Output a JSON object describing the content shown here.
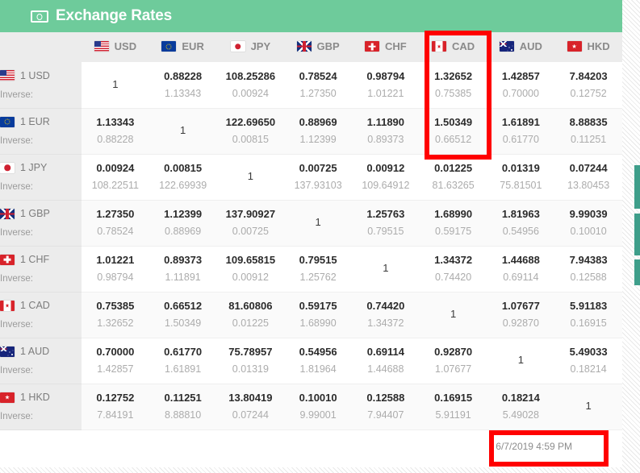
{
  "header": {
    "title": "Exchange Rates",
    "icon": "money-bill-icon",
    "background_color": "#6ECB9B"
  },
  "table": {
    "inverse_label": "Inverse:",
    "identity_value": "1",
    "columns": [
      {
        "code": "USD",
        "flag": "flag-usd"
      },
      {
        "code": "EUR",
        "flag": "flag-eur"
      },
      {
        "code": "JPY",
        "flag": "flag-jpy"
      },
      {
        "code": "GBP",
        "flag": "flag-gbp"
      },
      {
        "code": "CHF",
        "flag": "flag-chf"
      },
      {
        "code": "CAD",
        "flag": "flag-cad"
      },
      {
        "code": "AUD",
        "flag": "flag-aud"
      },
      {
        "code": "HKD",
        "flag": "flag-hkd"
      }
    ],
    "rows": [
      {
        "label": "1 USD",
        "flag": "flag-usd",
        "rates": [
          "1",
          "0.88228",
          "108.25286",
          "0.78524",
          "0.98794",
          "1.32652",
          "1.42857",
          "7.84203"
        ],
        "inverses": [
          "",
          "1.13343",
          "0.00924",
          "1.27350",
          "1.01221",
          "0.75385",
          "0.70000",
          "0.12752"
        ]
      },
      {
        "label": "1 EUR",
        "flag": "flag-eur",
        "rates": [
          "1.13343",
          "1",
          "122.69650",
          "0.88969",
          "1.11890",
          "1.50349",
          "1.61891",
          "8.88835"
        ],
        "inverses": [
          "0.88228",
          "",
          "0.00815",
          "1.12399",
          "0.89373",
          "0.66512",
          "0.61770",
          "0.11251"
        ]
      },
      {
        "label": "1 JPY",
        "flag": "flag-jpy",
        "rates": [
          "0.00924",
          "0.00815",
          "1",
          "0.00725",
          "0.00912",
          "0.01225",
          "0.01319",
          "0.07244"
        ],
        "inverses": [
          "108.22511",
          "122.69939",
          "",
          "137.93103",
          "109.64912",
          "81.63265",
          "75.81501",
          "13.80453"
        ]
      },
      {
        "label": "1 GBP",
        "flag": "flag-gbp",
        "rates": [
          "1.27350",
          "1.12399",
          "137.90927",
          "1",
          "1.25763",
          "1.68990",
          "1.81963",
          "9.99039"
        ],
        "inverses": [
          "0.78524",
          "0.88969",
          "0.00725",
          "",
          "0.79515",
          "0.59175",
          "0.54956",
          "0.10010"
        ]
      },
      {
        "label": "1 CHF",
        "flag": "flag-chf",
        "rates": [
          "1.01221",
          "0.89373",
          "109.65815",
          "0.79515",
          "1",
          "1.34372",
          "1.44688",
          "7.94383"
        ],
        "inverses": [
          "0.98794",
          "1.11891",
          "0.00912",
          "1.25762",
          "",
          "0.74420",
          "0.69114",
          "0.12588"
        ]
      },
      {
        "label": "1 CAD",
        "flag": "flag-cad",
        "rates": [
          "0.75385",
          "0.66512",
          "81.60806",
          "0.59175",
          "0.74420",
          "1",
          "1.07677",
          "5.91183"
        ],
        "inverses": [
          "1.32652",
          "1.50349",
          "0.01225",
          "1.68990",
          "1.34372",
          "",
          "0.92870",
          "0.16915"
        ]
      },
      {
        "label": "1 AUD",
        "flag": "flag-aud",
        "rates": [
          "0.70000",
          "0.61770",
          "75.78957",
          "0.54956",
          "0.69114",
          "0.92870",
          "1",
          "5.49033"
        ],
        "inverses": [
          "1.42857",
          "1.61891",
          "0.01319",
          "1.81964",
          "1.44688",
          "1.07677",
          "",
          "0.18214"
        ]
      },
      {
        "label": "1 HKD",
        "flag": "flag-hkd",
        "rates": [
          "0.12752",
          "0.11251",
          "13.80419",
          "0.10010",
          "0.12588",
          "0.16915",
          "0.18214",
          "1"
        ],
        "inverses": [
          "7.84191",
          "8.88810",
          "0.07244",
          "9.99001",
          "7.94407",
          "5.91191",
          "5.49028",
          ""
        ]
      }
    ]
  },
  "footer": {
    "timestamp": "6/7/2019 4:59 PM"
  },
  "annotations": {
    "color": "#FF0000",
    "cad_column_highlight": "CAD",
    "timestamp_highlight": "6/7/2019 4:59 PM"
  }
}
